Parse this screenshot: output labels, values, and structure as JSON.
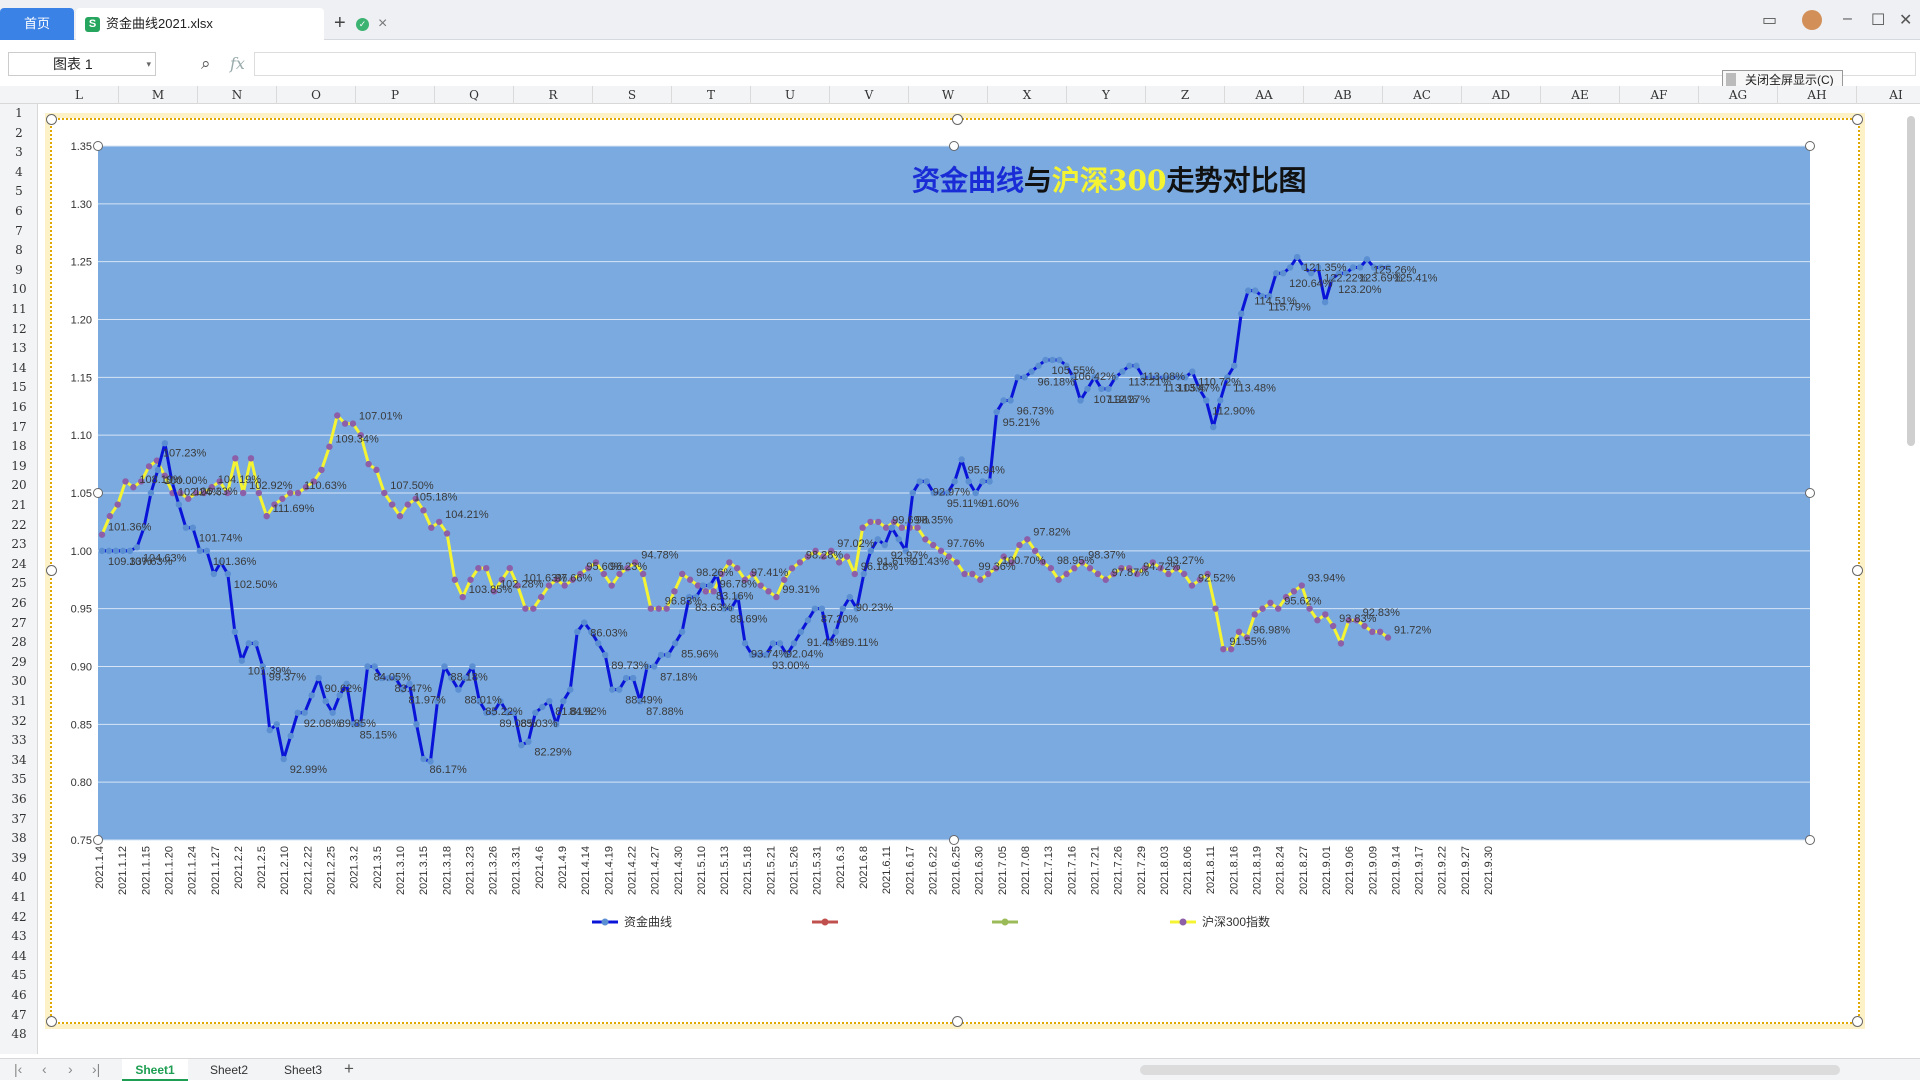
{
  "tabs": {
    "home": "首页",
    "file": "资金曲线2021.xlsx"
  },
  "formula_bar": {
    "name_box": "图表 1",
    "fx": "fx",
    "value": ""
  },
  "toolbar": {
    "exit_fullscreen": "关闭全屏显示(C)"
  },
  "columns": [
    "L",
    "M",
    "N",
    "O",
    "P",
    "Q",
    "R",
    "S",
    "T",
    "U",
    "V",
    "W",
    "X",
    "Y",
    "Z",
    "AA",
    "AB",
    "AC",
    "AD",
    "AE",
    "AF",
    "AG",
    "AH",
    "AI"
  ],
  "rows": [
    "1",
    "2",
    "3",
    "4",
    "5",
    "6",
    "7",
    "8",
    "9",
    "10",
    "11",
    "12",
    "13",
    "14",
    "15",
    "16",
    "17",
    "18",
    "19",
    "20",
    "21",
    "22",
    "23",
    "24",
    "25",
    "26",
    "27",
    "28",
    "29",
    "30",
    "31",
    "32",
    "33",
    "34",
    "35",
    "36",
    "37",
    "38",
    "39",
    "40",
    "41",
    "42",
    "43",
    "44",
    "45",
    "46",
    "47",
    "48"
  ],
  "sheets": [
    "Sheet1",
    "Sheet2",
    "Sheet3"
  ],
  "colors": {
    "plot_bg": "#7aaae0",
    "fund": "#0a14d8",
    "fund_marker": "#5b8fd1",
    "hs300": "#f4f433",
    "hs300_marker": "#8c5fa8",
    "title_blue": "#1a2cd6",
    "title_yellow": "#f4f433",
    "title_black": "#111111"
  },
  "chart_data": {
    "type": "line",
    "title_parts": [
      "资金曲线",
      "与",
      "沪深300",
      "走势对比图"
    ],
    "ylim": [
      0.75,
      1.35
    ],
    "yticks": [
      "1.35",
      "1.30",
      "1.25",
      "1.20",
      "1.15",
      "1.10",
      "1.05",
      "1.00",
      "0.95",
      "0.90",
      "0.85",
      "0.80",
      "0.75"
    ],
    "xticks": [
      "2021.1.4",
      "2021.1.12",
      "2021.1.15",
      "2021.1.20",
      "2021.1.24",
      "2021.1.27",
      "2021.2.2",
      "2021.2.5",
      "2021.2.10",
      "2021.2.22",
      "2021.2.25",
      "2021.3.2",
      "2021.3.5",
      "2021.3.10",
      "2021.3.15",
      "2021.3.18",
      "2021.3.23",
      "2021.3.26",
      "2021.3.31",
      "2021.4.6",
      "2021.4.9",
      "2021.4.14",
      "2021.4.19",
      "2021.4.22",
      "2021.4.27",
      "2021.4.30",
      "2021.5.10",
      "2021.5.13",
      "2021.5.18",
      "2021.5.21",
      "2021.5.26",
      "2021.5.31",
      "2021.6.3",
      "2021.6.8",
      "2021.6.11",
      "2021.6.17",
      "2021.6.22",
      "2021.6.25",
      "2021.6.30",
      "2021.7.05",
      "2021.7.08",
      "2021.7.13",
      "2021.7.16",
      "2021.7.21",
      "2021.7.26",
      "2021.7.29",
      "2021.8.03",
      "2021.8.06",
      "2021.8.11",
      "2021.8.16",
      "2021.8.19",
      "2021.8.24",
      "2021.8.27",
      "2021.9.01",
      "2021.9.06",
      "2021.9.09",
      "2021.9.14",
      "2021.9.17",
      "2021.9.22",
      "2021.9.27",
      "2021.9.30"
    ],
    "grid": true,
    "legend_position": "bottom",
    "legend": [
      "资金曲线",
      "",
      "",
      "沪深300指数"
    ],
    "series": [
      {
        "name": "资金曲线",
        "values": [
          1.0,
          1.0,
          1.0,
          1.0,
          1.0,
          1.003,
          1.02,
          1.05,
          1.07,
          1.093,
          1.06,
          1.04,
          1.02,
          1.02,
          1.0,
          1.0,
          0.98,
          0.99,
          0.98,
          0.93,
          0.905,
          0.92,
          0.92,
          0.9,
          0.845,
          0.85,
          0.82,
          0.84,
          0.86,
          0.86,
          0.875,
          0.89,
          0.87,
          0.86,
          0.875,
          0.885,
          0.85,
          0.85,
          0.9,
          0.9,
          0.89,
          0.89,
          0.89,
          0.88,
          0.885,
          0.85,
          0.82,
          0.818,
          0.87,
          0.9,
          0.89,
          0.88,
          0.89,
          0.9,
          0.87,
          0.86,
          0.86,
          0.87,
          0.86,
          0.86,
          0.832,
          0.835,
          0.86,
          0.865,
          0.87,
          0.85,
          0.87,
          0.88,
          0.93,
          0.938,
          0.93,
          0.92,
          0.91,
          0.88,
          0.88,
          0.89,
          0.89,
          0.87,
          0.9,
          0.9,
          0.91,
          0.91,
          0.92,
          0.93,
          0.96,
          0.96,
          0.97,
          0.97,
          0.98,
          0.95,
          0.95,
          0.96,
          0.92,
          0.91,
          0.91,
          0.91,
          0.92,
          0.92,
          0.91,
          0.92,
          0.93,
          0.94,
          0.95,
          0.95,
          0.92,
          0.93,
          0.95,
          0.96,
          0.95,
          0.98,
          1.0,
          1.01,
          1.005,
          1.02,
          1.01,
          1.0,
          1.05,
          1.06,
          1.06,
          1.05,
          1.05,
          1.05,
          1.06,
          1.079,
          1.06,
          1.05,
          1.06,
          1.06,
          1.12,
          1.13,
          1.13,
          1.15,
          1.15,
          1.155,
          1.16,
          1.165,
          1.165,
          1.165,
          1.16,
          1.15,
          1.13,
          1.14,
          1.15,
          1.14,
          1.14,
          1.15,
          1.155,
          1.16,
          1.16,
          1.15,
          1.15,
          1.15,
          1.15,
          1.15,
          1.15,
          1.15,
          1.155,
          1.14,
          1.13,
          1.107,
          1.13,
          1.15,
          1.16,
          1.205,
          1.225,
          1.225,
          1.22,
          1.22,
          1.24,
          1.24,
          1.245,
          1.254,
          1.245,
          1.24,
          1.245,
          1.215,
          1.235,
          1.24,
          1.24,
          1.245,
          1.245,
          1.252,
          1.245,
          1.245,
          1.245
        ]
      },
      {
        "name": "沪深300指数",
        "values": [
          1.014,
          1.03,
          1.04,
          1.06,
          1.055,
          1.06,
          1.073,
          1.078,
          1.065,
          1.05,
          1.05,
          1.045,
          1.05,
          1.05,
          1.055,
          1.06,
          1.05,
          1.08,
          1.05,
          1.08,
          1.05,
          1.03,
          1.04,
          1.045,
          1.05,
          1.05,
          1.055,
          1.06,
          1.07,
          1.09,
          1.117,
          1.11,
          1.11,
          1.1,
          1.075,
          1.07,
          1.05,
          1.04,
          1.03,
          1.04,
          1.045,
          1.035,
          1.02,
          1.025,
          1.015,
          0.975,
          0.96,
          0.975,
          0.985,
          0.985,
          0.965,
          0.975,
          0.985,
          0.97,
          0.95,
          0.95,
          0.96,
          0.97,
          0.975,
          0.97,
          0.975,
          0.98,
          0.985,
          0.99,
          0.98,
          0.97,
          0.98,
          0.985,
          0.99,
          0.98,
          0.95,
          0.95,
          0.95,
          0.965,
          0.98,
          0.975,
          0.97,
          0.965,
          0.965,
          0.98,
          0.99,
          0.985,
          0.975,
          0.98,
          0.97,
          0.965,
          0.96,
          0.975,
          0.985,
          0.99,
          0.995,
          1.0,
          0.995,
          1.0,
          0.99,
          0.995,
          0.98,
          1.02,
          1.025,
          1.025,
          1.02,
          1.025,
          1.02,
          1.02,
          1.02,
          1.01,
          1.005,
          1.0,
          0.995,
          0.99,
          0.98,
          0.98,
          0.975,
          0.98,
          0.985,
          0.995,
          0.99,
          1.005,
          1.01,
          1.0,
          0.99,
          0.985,
          0.975,
          0.98,
          0.985,
          0.99,
          0.985,
          0.98,
          0.975,
          0.98,
          0.985,
          0.985,
          0.98,
          0.985,
          0.99,
          0.985,
          0.98,
          0.985,
          0.98,
          0.97,
          0.975,
          0.98,
          0.95,
          0.915,
          0.915,
          0.93,
          0.925,
          0.945,
          0.95,
          0.955,
          0.95,
          0.96,
          0.965,
          0.97,
          0.95,
          0.94,
          0.945,
          0.935,
          0.92,
          0.94,
          0.94,
          0.935,
          0.93,
          0.93,
          0.925
        ],
        "x_end_index": 160
      }
    ],
    "data_labels": {
      "fund": [
        "109.33%",
        "107.63%",
        "104.63%",
        "100.00%",
        "102.24%",
        "101.74%",
        "101.36%",
        "102.50%",
        "101.39%",
        "99.37%",
        "92.99%",
        "92.08%",
        "90.62%",
        "89.85%",
        "85.15%",
        "84.05%",
        "83.47%",
        "81.97%",
        "86.17%",
        "88.18%",
        "88.01%",
        "85.22%",
        "89.08%",
        "85.03%",
        "82.29%",
        "81.81%",
        "84.92%",
        "86.03%",
        "89.73%",
        "88.49%",
        "87.88%",
        "87.18%",
        "85.96%",
        "83.63%",
        "83.16%",
        "89.69%",
        "93.74%",
        "93.00%",
        "92.04%",
        "91.43%",
        "87.20%",
        "89.11%",
        "90.23%",
        "91.61%",
        "92.97%",
        "91.43%",
        "92.97%",
        "95.11%",
        "95.94%",
        "91.60%",
        "95.21%",
        "96.73%",
        "96.18%",
        "105.55%",
        "106.42%",
        "107.94%",
        "112.27%",
        "113.21%",
        "113.08%",
        "113.05%",
        "113.47%",
        "110.72%",
        "112.90%",
        "113.48%",
        "114.51%",
        "115.79%",
        "120.64%",
        "121.35%",
        "122.22%",
        "123.20%",
        "123.69%",
        "125.26%",
        "125.41%"
      ],
      "hs300": [
        "101.36%",
        "108.19%",
        "107.23%",
        "106.33%",
        "104.19%",
        "102.92%",
        "111.69%",
        "110.63%",
        "109.34%",
        "107.01%",
        "107.50%",
        "105.18%",
        "104.21%",
        "103.85%",
        "102.28%",
        "101.63%",
        "97.66%",
        "95.60%",
        "96.23%",
        "94.78%",
        "96.83%",
        "98.26%",
        "96.78%",
        "97.41%",
        "99.31%",
        "98.28%",
        "97.02%",
        "96.18%",
        "99.69%",
        "98.35%",
        "97.76%",
        "99.36%",
        "100.70%",
        "97.82%",
        "98.95%",
        "98.37%",
        "97.87%",
        "94.72%",
        "93.27%",
        "92.52%",
        "91.55%",
        "96.98%",
        "95.62%",
        "93.94%",
        "93.83%",
        "92.83%",
        "91.72%"
      ]
    }
  }
}
